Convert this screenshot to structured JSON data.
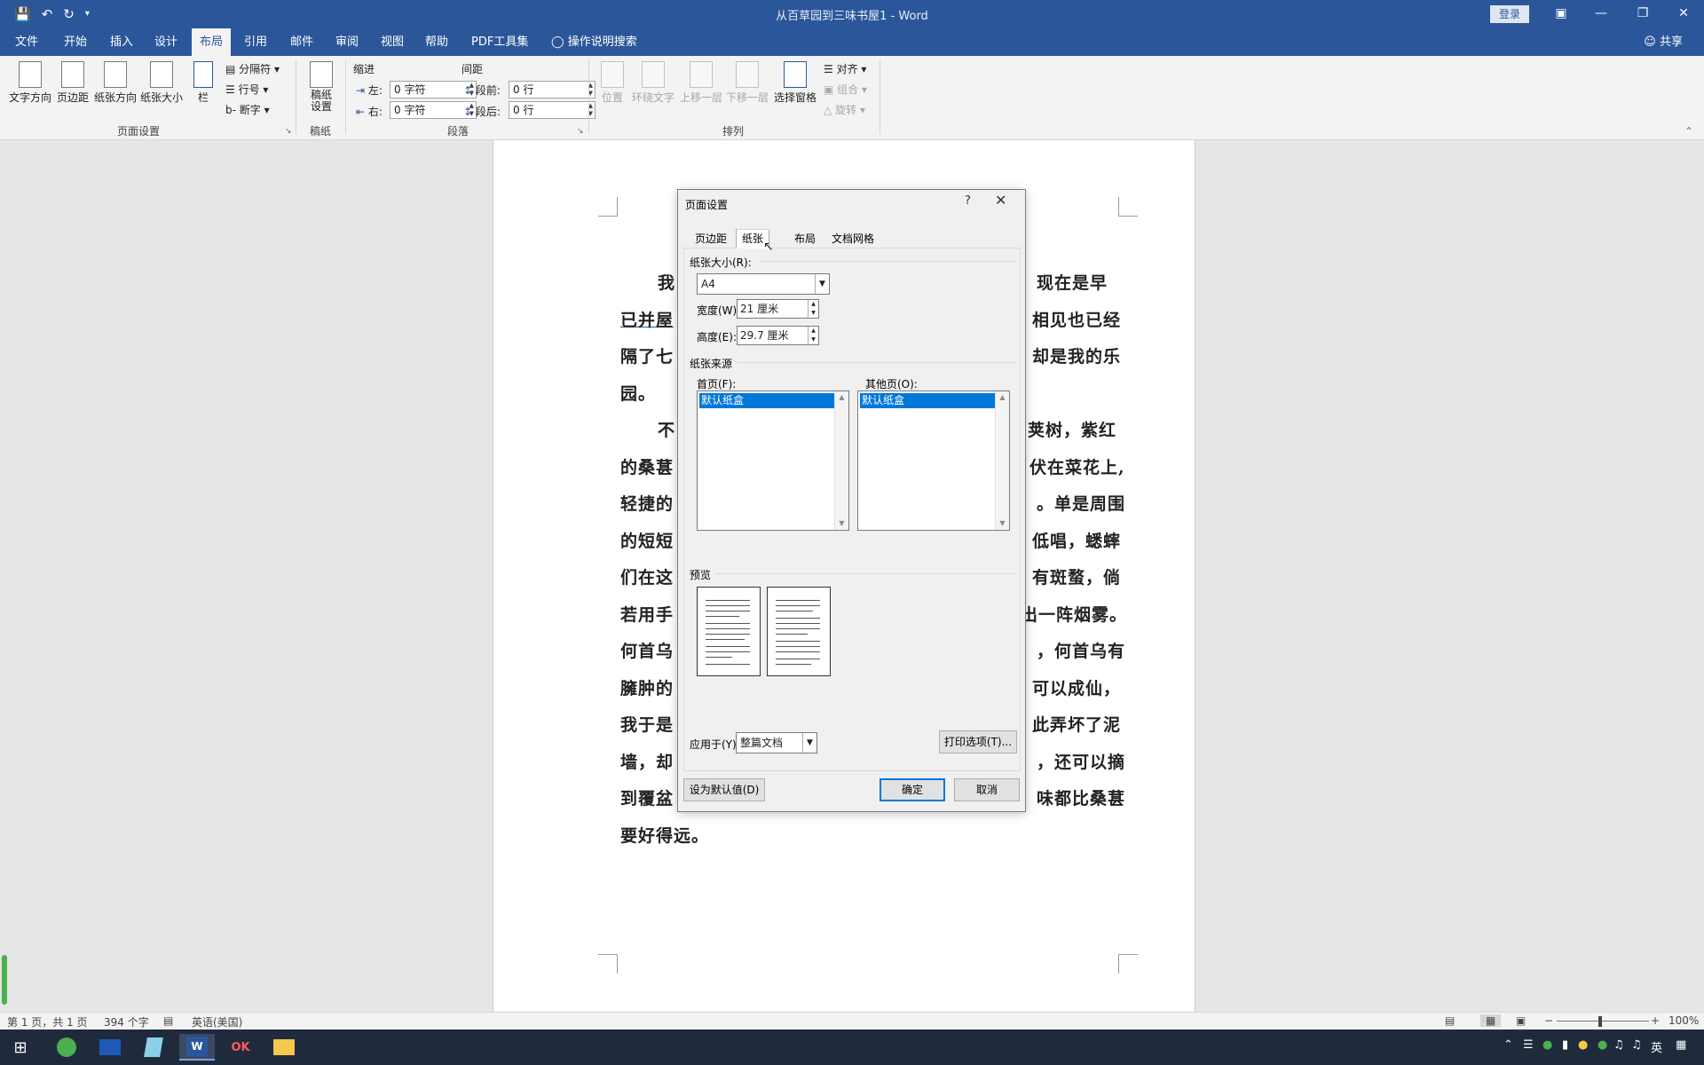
{
  "app": {
    "document_title": "从百草园到三味书屋1 - Word",
    "login_label": "登录"
  },
  "quick_access": {
    "save_icon": "save-icon",
    "undo_icon": "undo-icon",
    "redo_icon": "redo-icon",
    "customize_label": "▾"
  },
  "menu": {
    "tabs": [
      "文件",
      "开始",
      "插入",
      "设计",
      "布局",
      "引用",
      "邮件",
      "审阅",
      "视图",
      "帮助",
      "PDF工具集"
    ],
    "active_tab": "布局",
    "tell_me": "操作说明搜索",
    "share": "共享"
  },
  "ribbon": {
    "page_setup": {
      "buttons": [
        "文字方向",
        "页边距",
        "纸张方向",
        "纸张大小",
        "栏"
      ],
      "small": [
        "分隔符",
        "行号",
        "断字"
      ],
      "label": "页面设置"
    },
    "draft": {
      "button": "稿纸\n设置",
      "label": "稿纸"
    },
    "paragraph": {
      "indent_title": "缩进",
      "spacing_title": "间距",
      "left_label": "左:",
      "right_label": "右:",
      "before_label": "段前:",
      "after_label": "段后:",
      "left_value": "0 字符",
      "right_value": "0 字符",
      "before_value": "0 行",
      "after_value": "0 行",
      "label": "段落"
    },
    "arrange": {
      "buttons": [
        "位置",
        "环绕文字",
        "上移一层",
        "下移一层",
        "选择窗格"
      ],
      "small": [
        "对齐",
        "组合",
        "旋转"
      ],
      "label": "排列"
    }
  },
  "document": {
    "lines": [
      "我",
      "。现在是早",
      "已并屋",
      "相见也已经",
      "隔了七",
      "却是我的乐",
      "园。",
      "不",
      "荚树，紫红",
      "的桑葚",
      "伏在菜花上,",
      "轻捷的",
      "。单是周围",
      "的短短",
      "低唱，蟋蟀",
      "们在这",
      "有斑蝥，倘",
      "若用手",
      "出一阵烟雾。",
      "何首乌",
      "，何首乌有",
      "臃肿的",
      "可以成仙，",
      "我于是",
      "此弄坏了泥",
      "墙，却",
      "，还可以摘",
      "到覆盆",
      "味都比桑葚",
      "要好得远。"
    ]
  },
  "dialog": {
    "title": "页面设置",
    "help": "?",
    "tabs": [
      "页边距",
      "纸张",
      "布局",
      "文档网格"
    ],
    "active_tab": "纸张",
    "paper_size_label": "纸张大小(R):",
    "paper_size_value": "A4",
    "width_label": "宽度(W):",
    "width_value": "21 厘米",
    "height_label": "高度(E):",
    "height_value": "29.7 厘米",
    "paper_source_label": "纸张来源",
    "first_page_label": "首页(F):",
    "first_page_selected": "默认纸盒",
    "other_pages_label": "其他页(O):",
    "other_pages_selected": "默认纸盒",
    "preview_label": "预览",
    "apply_to_label": "应用于(Y):",
    "apply_to_value": "整篇文档",
    "print_options": "打印选项(T)...",
    "set_default": "设为默认值(D)",
    "ok": "确定",
    "cancel": "取消"
  },
  "status": {
    "page": "第 1 页，共 1 页",
    "words": "394 个字",
    "language": "英语(美国)",
    "zoom": "100%"
  },
  "taskbar": {
    "apps": [
      "browser-icon",
      "video-editor-icon",
      "notes-icon",
      "word-icon",
      "ok-app-icon",
      "file-explorer-icon"
    ],
    "ime": "英"
  },
  "colors": {
    "brand": "#2b579a",
    "selection": "#0078d7"
  }
}
